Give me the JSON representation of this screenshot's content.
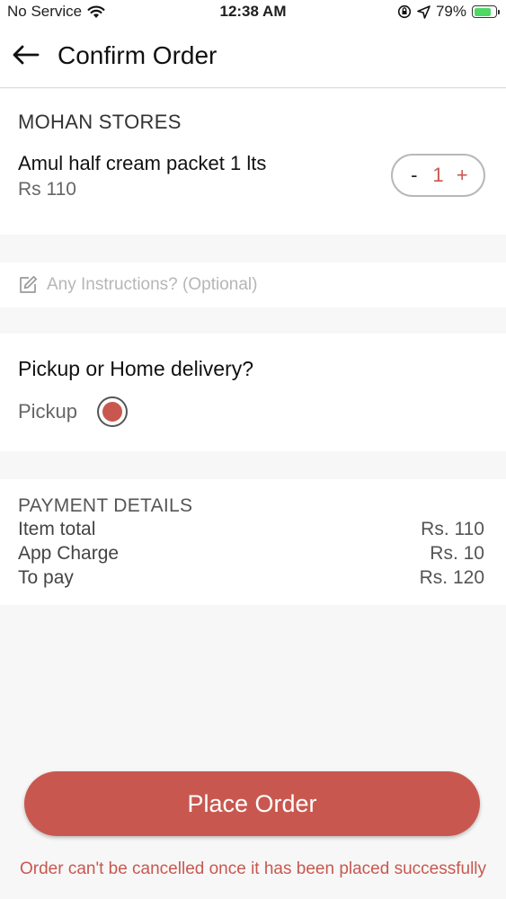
{
  "status_bar": {
    "carrier": "No Service",
    "time": "12:38 AM",
    "battery": "79%",
    "battery_level": 0.79,
    "icons": [
      "wifi-icon",
      "orientation-lock-icon",
      "location-arrow-icon",
      "battery-icon"
    ]
  },
  "header": {
    "title": "Confirm Order",
    "back_icon": "arrow-left-icon"
  },
  "store": {
    "name": "MOHAN STORES",
    "item": {
      "name": "Amul half cream packet 1 lts",
      "price": "Rs 110",
      "quantity": "1",
      "minus_label": "-",
      "plus_label": "+"
    }
  },
  "instructions": {
    "placeholder": "Any Instructions? (Optional)",
    "value": "",
    "icon": "edit-icon"
  },
  "delivery": {
    "question": "Pickup or Home delivery?",
    "option_label": "Pickup",
    "selected": true
  },
  "payment": {
    "heading": "PAYMENT DETAILS",
    "rows": [
      {
        "label": "Item total",
        "amount": "Rs. 110"
      },
      {
        "label": "App Charge",
        "amount": "Rs. 10"
      },
      {
        "label": "To pay",
        "amount": "Rs. 120"
      }
    ]
  },
  "actions": {
    "place_order": "Place Order",
    "warning": "Order can't be cancelled once it has been placed successfully"
  },
  "colors": {
    "accent": "#c8584f",
    "background": "#f7f7f7",
    "surface": "#ffffff"
  }
}
